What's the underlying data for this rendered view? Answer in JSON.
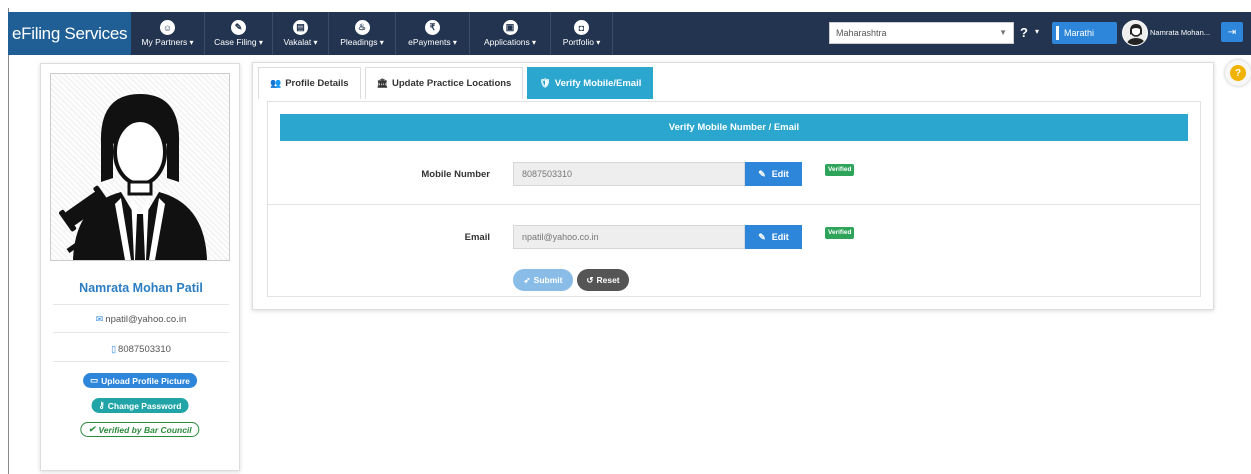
{
  "navbar": {
    "brand": "eFiling Services",
    "items": [
      {
        "label": "My Partners",
        "icon": "partners-icon",
        "glyph": "☺"
      },
      {
        "label": "Case Filing",
        "icon": "pencil-icon",
        "glyph": "✎"
      },
      {
        "label": "Vakalat",
        "icon": "document-icon",
        "glyph": "▤"
      },
      {
        "label": "Pleadings",
        "icon": "handshake-icon",
        "glyph": "♨"
      },
      {
        "label": "ePayments",
        "icon": "rupee-icon",
        "glyph": "₹"
      },
      {
        "label": "Applications",
        "icon": "file-icon",
        "glyph": "▣"
      },
      {
        "label": "Portfolio",
        "icon": "briefcase-icon",
        "glyph": "◘"
      }
    ],
    "state_selected": "Maharashtra",
    "help": "?",
    "language_button": "Marathi",
    "user_name": "Namrata Mohan...",
    "logout_glyph": "⇥"
  },
  "float_help": "?",
  "profile": {
    "name": "Namrata Mohan Patil",
    "email": "npatil@yahoo.co.in",
    "mobile": "8087503310",
    "upload_picture": "Upload Profile Picture",
    "change_password": "Change Password",
    "verified_bar_council": "Verified by Bar Council"
  },
  "tabs": [
    {
      "label": "Profile Details",
      "glyph": "👥",
      "active": false
    },
    {
      "label": "Update Practice Locations",
      "glyph": "🏛",
      "active": false
    },
    {
      "label": "Verify Mobile/Email",
      "glyph": "🛡",
      "active": true
    }
  ],
  "verify": {
    "heading": "Verify Mobile Number / Email",
    "mobile_label": "Mobile Number",
    "mobile_value": "8087503310",
    "email_label": "Email",
    "email_value": "npatil@yahoo.co.in",
    "edit_label": "Edit",
    "verified_badge": "Verified",
    "submit_label": "Submit",
    "reset_label": "Reset"
  },
  "colors": {
    "navbar": "#22344f",
    "brand": "#1f5f96",
    "accent": "#2ba6cf",
    "button_blue": "#2d86d9",
    "verified_green": "#2ea35a"
  }
}
